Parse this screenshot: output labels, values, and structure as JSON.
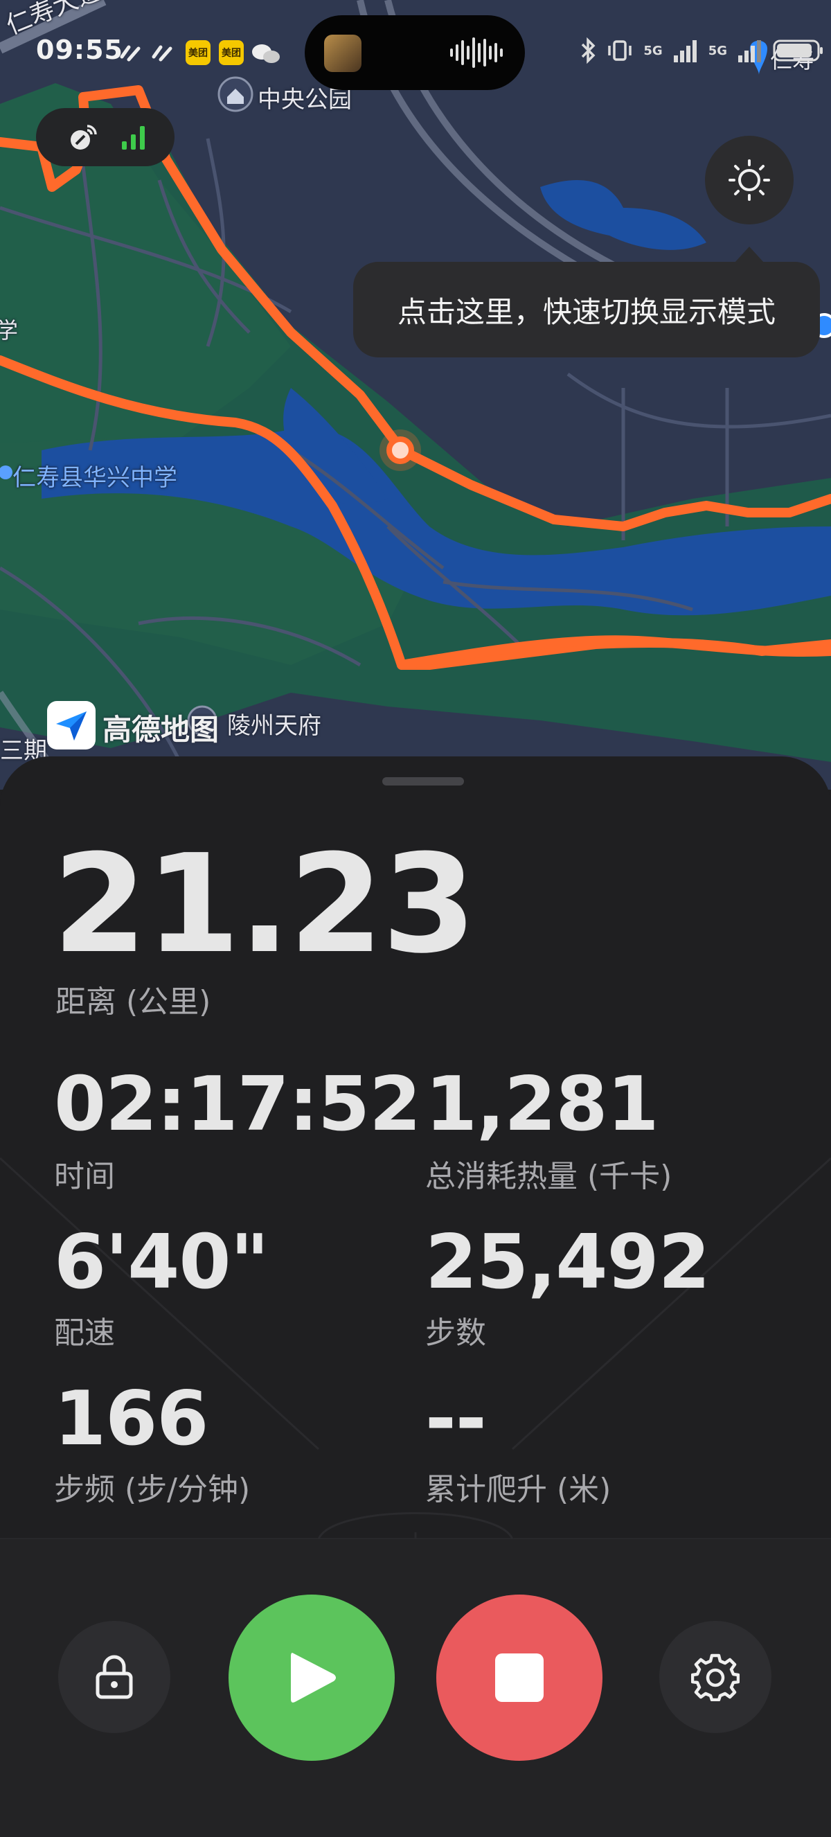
{
  "status_bar": {
    "time": "09:55",
    "app_badges": [
      "美团",
      "美团"
    ],
    "signal_labels": [
      "5G",
      "5G"
    ]
  },
  "map": {
    "labels": {
      "park": "中央公园",
      "school": "仁寿县华兴中学",
      "residence": "陵州天府",
      "road_top": "仁寿大道",
      "road_right": "仁寿",
      "left_edge_top": "学",
      "left_edge_bottom": "三期"
    },
    "provider": "高德地图",
    "route_color": "#ff6a2b",
    "tooltip": "点击这里，快速切换显示模式"
  },
  "stats": {
    "distance": {
      "value": "21.23",
      "label": "距离 (公里)"
    },
    "duration": {
      "value": "02:17:52",
      "label": "时间"
    },
    "calories": {
      "value": "1,281",
      "label": "总消耗热量 (千卡)"
    },
    "pace": {
      "value": "6'40\"",
      "label": "配速"
    },
    "steps": {
      "value": "25,492",
      "label": "步数"
    },
    "cadence": {
      "value": "166",
      "label": "步频 (步/分钟)"
    },
    "elevation": {
      "value": "--",
      "label": "累计爬升 (米)"
    }
  },
  "controls": {
    "lock_icon": "lock-icon",
    "resume_icon": "play-icon",
    "stop_icon": "stop-icon",
    "settings_icon": "gear-icon"
  },
  "colors": {
    "resume": "#5cc45c",
    "stop": "#ea5a5d",
    "gps_signal": "#3ecb4b"
  }
}
